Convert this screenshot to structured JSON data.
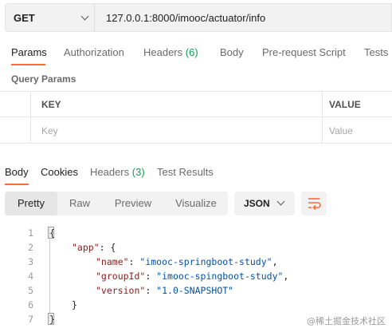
{
  "request": {
    "method": "GET",
    "url": "127.0.0.1:8000/imooc/actuator/info"
  },
  "request_tabs": {
    "params": "Params",
    "authorization": "Authorization",
    "headers": "Headers",
    "headers_count": "(6)",
    "body": "Body",
    "pre_request": "Pre-request Script",
    "tests": "Tests"
  },
  "query_params": {
    "title": "Query Params",
    "col_key": "KEY",
    "col_value": "VALUE",
    "key_placeholder": "Key",
    "value_placeholder": "Value"
  },
  "response_tabs": {
    "body": "Body",
    "cookies": "Cookies",
    "headers": "Headers",
    "headers_count": "(3)",
    "test_results": "Test Results"
  },
  "view_modes": {
    "pretty": "Pretty",
    "raw": "Raw",
    "preview": "Preview",
    "visualize": "Visualize"
  },
  "format": "JSON",
  "code": {
    "line_numbers": [
      "1",
      "2",
      "3",
      "4",
      "5",
      "6",
      "7"
    ],
    "open_brace": "{",
    "app_key": "\"app\"",
    "colon_open": ": {",
    "name_key": "\"name\"",
    "name_val": "\"imooc-springboot-study\"",
    "groupid_key": "\"groupId\"",
    "groupid_val": "\"imooc-spingboot-study\"",
    "version_key": "\"version\"",
    "version_val": "\"1.0-SNAPSHOT\"",
    "close_inner": "}",
    "close_brace": "}"
  },
  "watermark": "@稀土掘金技术社区",
  "colors": {
    "accent": "#ff6c37",
    "count_green": "#0f9d58",
    "json_key": "#8a1c1c",
    "json_string": "#0451a5"
  }
}
